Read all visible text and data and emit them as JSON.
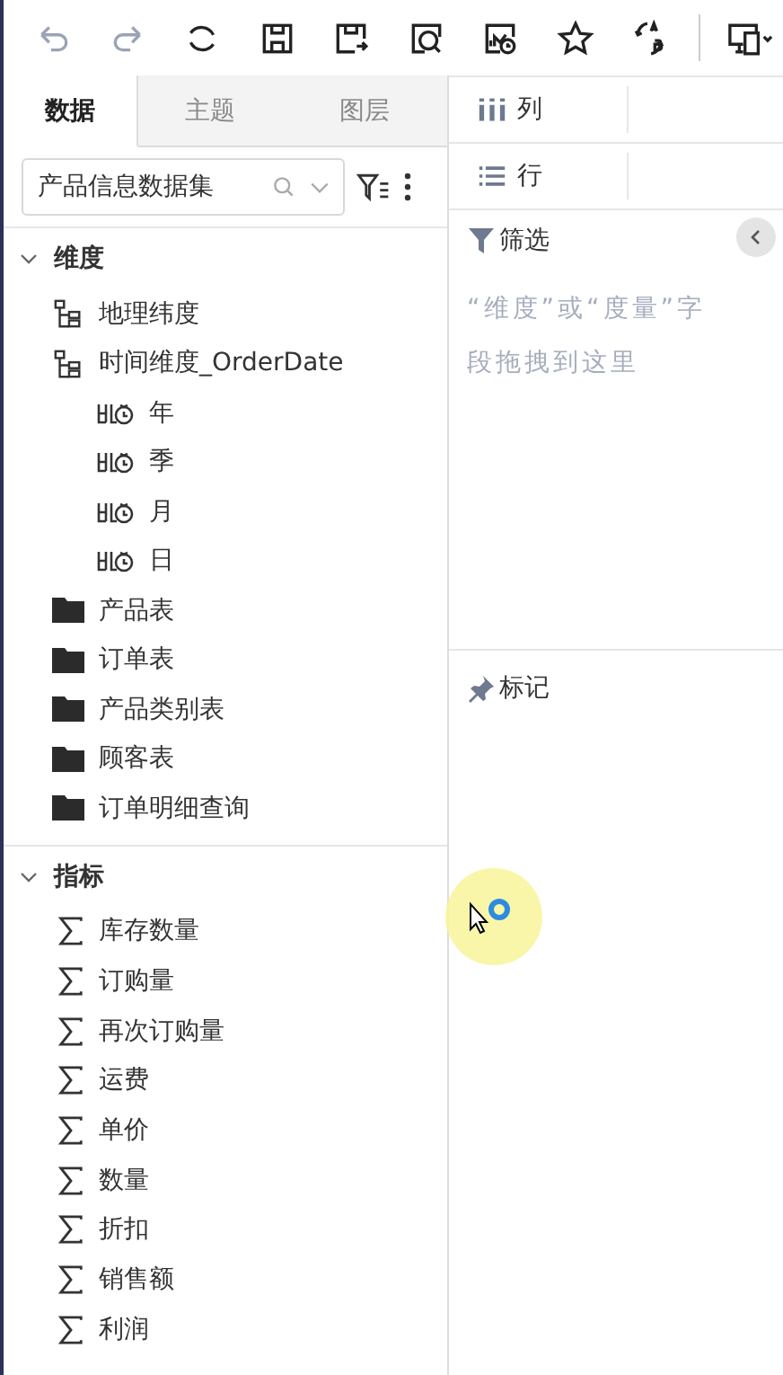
{
  "toolbar": [
    {
      "kind": "undo",
      "disabled": true
    },
    {
      "kind": "redo",
      "disabled": true
    },
    {
      "kind": "refresh",
      "disabled": false
    },
    {
      "kind": "save",
      "disabled": false
    },
    {
      "kind": "save-as",
      "disabled": false
    },
    {
      "kind": "preview",
      "disabled": false
    },
    {
      "kind": "schedule",
      "disabled": false
    },
    {
      "kind": "star",
      "disabled": false
    },
    {
      "kind": "swap",
      "disabled": false
    },
    {
      "kind": "divider"
    },
    {
      "kind": "device",
      "disabled": false
    }
  ],
  "tabs": [
    {
      "label": "数据",
      "selected": true
    },
    {
      "label": "主题",
      "selected": false
    },
    {
      "label": "图层",
      "selected": false
    }
  ],
  "dataset": {
    "value": "产品信息数据集"
  },
  "dimensions": {
    "title": "维度",
    "expanded": true,
    "items": [
      {
        "kind": "hierarchy",
        "label": "地理纬度"
      },
      {
        "kind": "hierarchy",
        "label": "时间维度_OrderDate",
        "children": [
          {
            "kind": "level",
            "label": "年"
          },
          {
            "kind": "level",
            "label": "季"
          },
          {
            "kind": "level",
            "label": "月"
          },
          {
            "kind": "level",
            "label": "日"
          }
        ]
      },
      {
        "kind": "folder",
        "label": "产品表"
      },
      {
        "kind": "folder",
        "label": "订单表"
      },
      {
        "kind": "folder",
        "label": "产品类别表"
      },
      {
        "kind": "folder",
        "label": "顾客表"
      },
      {
        "kind": "folder",
        "label": "订单明细查询"
      }
    ]
  },
  "measures": {
    "title": "指标",
    "expanded": true,
    "items": [
      {
        "kind": "measure",
        "label": "库存数量"
      },
      {
        "kind": "measure",
        "label": "订购量"
      },
      {
        "kind": "measure",
        "label": "再次订购量"
      },
      {
        "kind": "measure",
        "label": "运费"
      },
      {
        "kind": "measure",
        "label": "单价"
      },
      {
        "kind": "measure",
        "label": "数量"
      },
      {
        "kind": "measure",
        "label": "折扣"
      },
      {
        "kind": "measure",
        "label": "销售额"
      },
      {
        "kind": "measure",
        "label": "利润"
      }
    ]
  },
  "shelves": [
    {
      "kind": "columns",
      "label": "列"
    },
    {
      "kind": "rows",
      "label": "行"
    }
  ],
  "filter": {
    "title": "筛选",
    "placeholder": "“维度”或“度量”字段拖拽到这里"
  },
  "marks": {
    "title": "标记"
  }
}
